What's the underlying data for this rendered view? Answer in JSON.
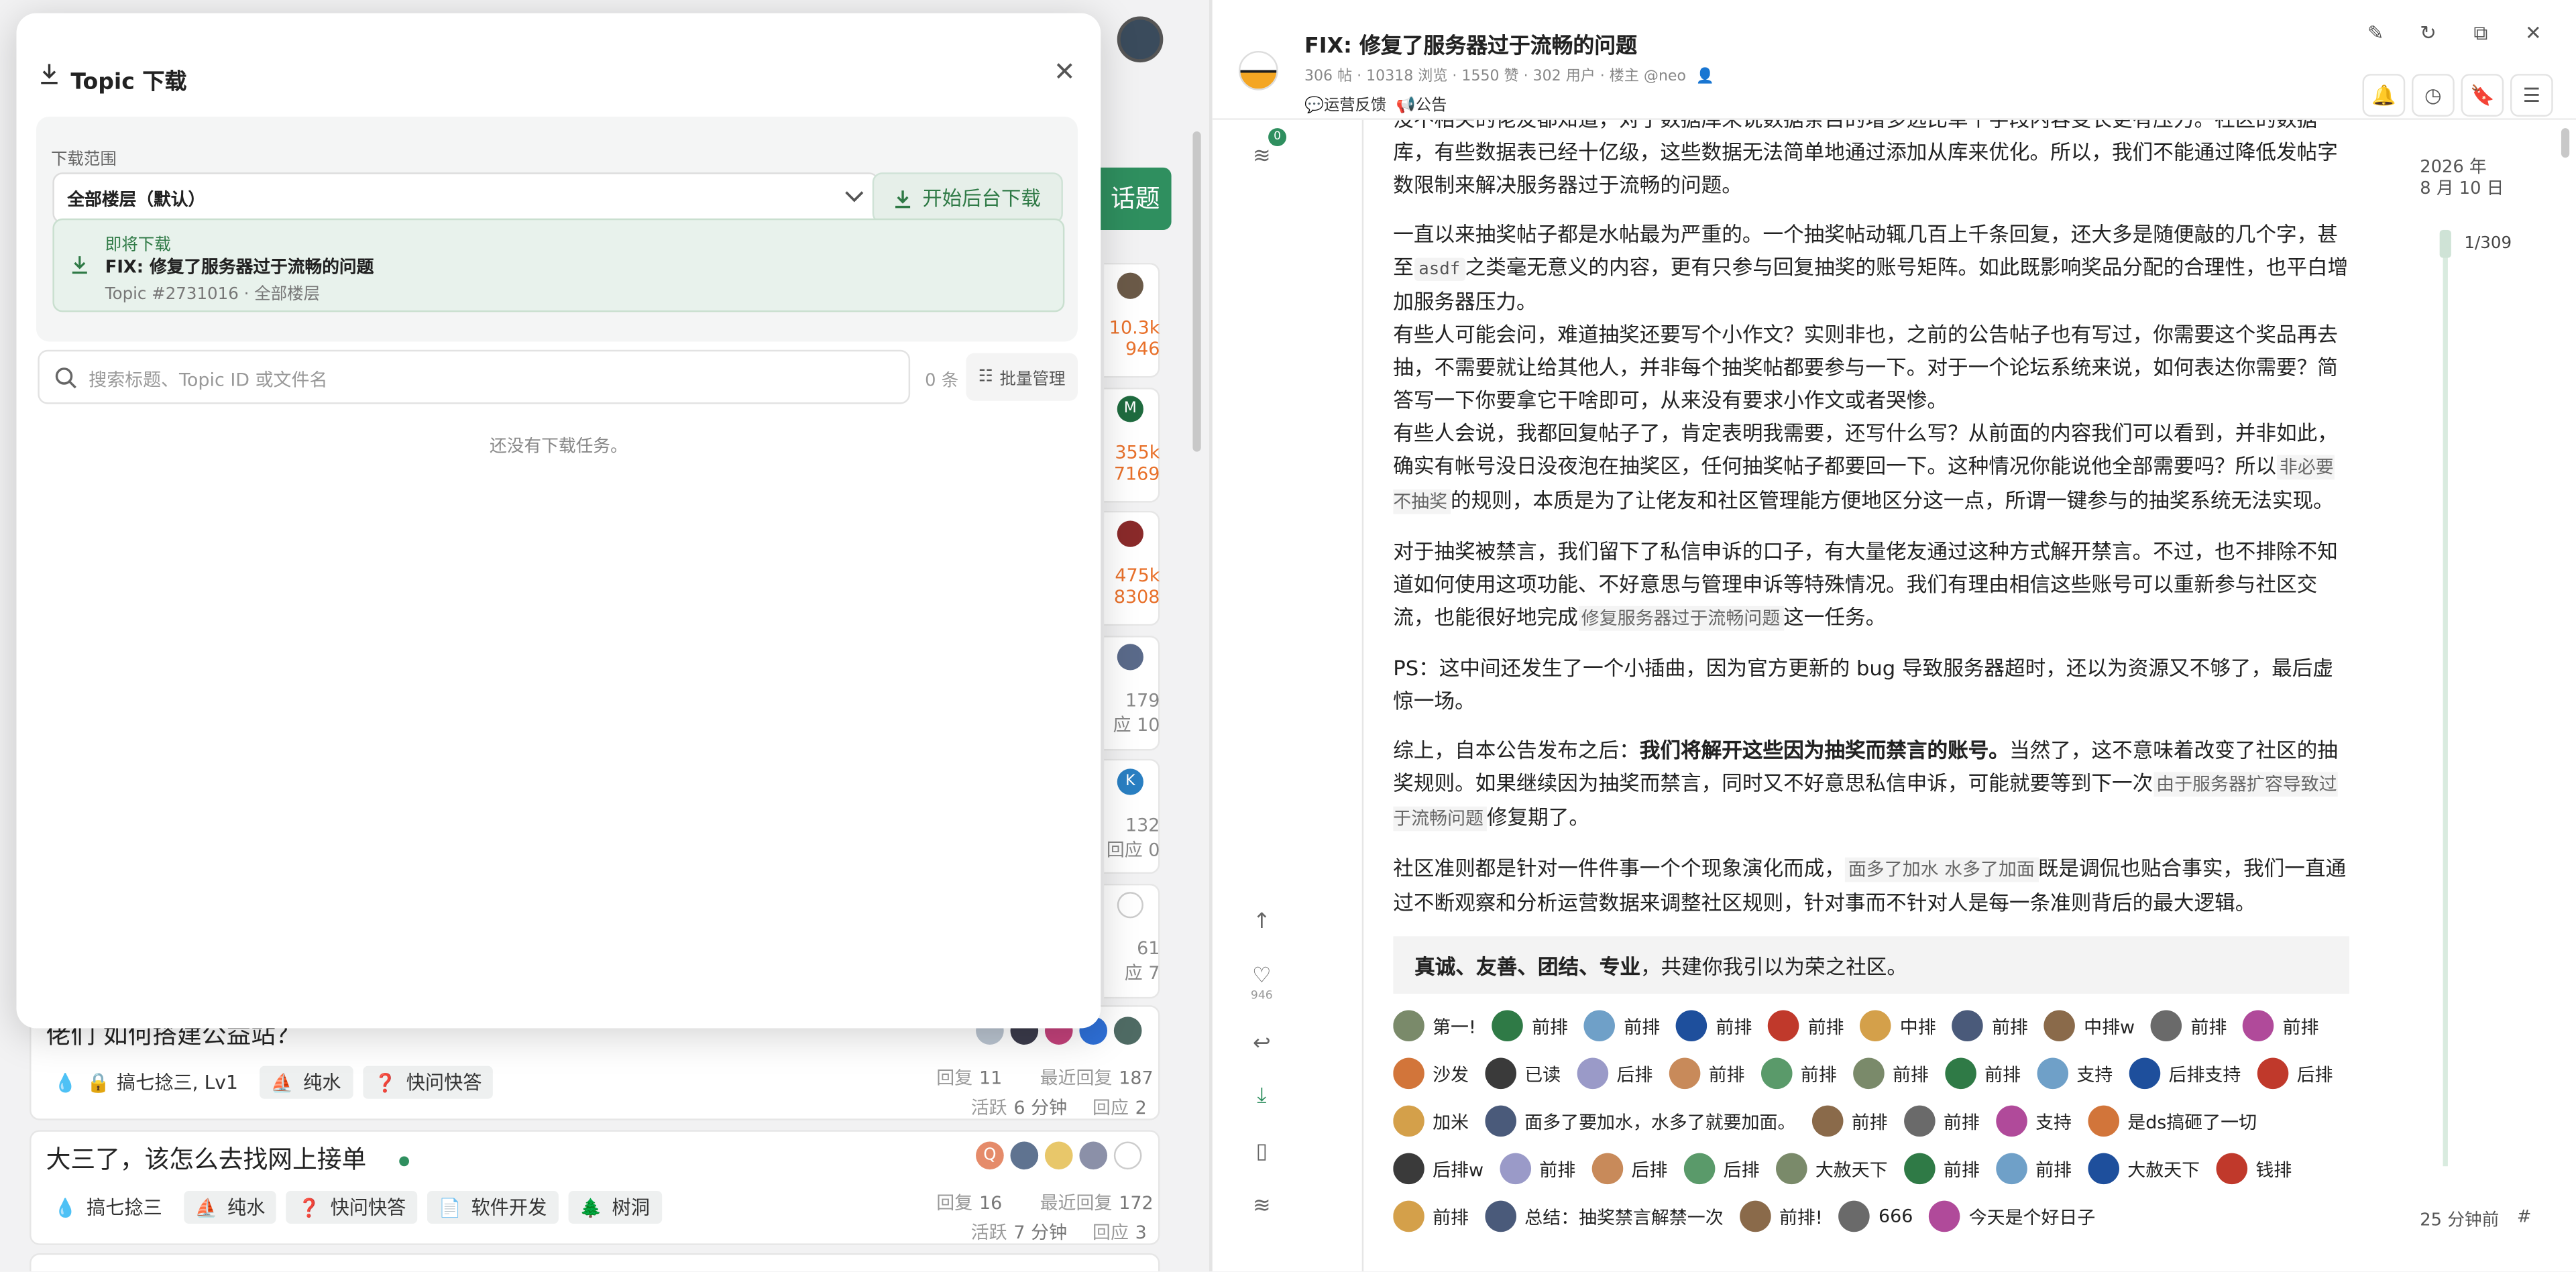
{
  "modal": {
    "title": "Topic 下载",
    "range_label": "下载范围",
    "range_value": "全部楼层（默认）",
    "start_button": "开始后台下载",
    "pending_label": "即将下载",
    "pending_title": "FIX: 修复了服务器过于流畅的问题",
    "pending_sub": "Topic #2731016 · 全部楼层",
    "search_placeholder": "搜索标题、Topic ID 或文件名",
    "count": "0 条",
    "bulk_label": "批量管理",
    "empty_text": "还没有下载任务。"
  },
  "left": {
    "new_topic_label": "话题",
    "right_column": [
      {
        "a": "10.3k",
        "b": "946"
      },
      {
        "a": "355k",
        "b": "7169"
      },
      {
        "a": "475k",
        "b": "8308"
      },
      {
        "a": "179",
        "b": "应 10"
      },
      {
        "a": "132",
        "b": "回应 0"
      },
      {
        "a": "61",
        "b": "应 7"
      }
    ],
    "topics": [
      {
        "title": "佬们 如何搭建公益站？",
        "tags": [
          {
            "icon": "drop-icon",
            "label": "搞七捻三, Lv1"
          },
          {
            "icon": "boat-icon",
            "label": "纯水"
          },
          {
            "icon": "question-icon",
            "label": "快问快答"
          }
        ],
        "reply_label": "回复",
        "reply_count": "11",
        "last_label": "最近回复",
        "last_value": "187",
        "active_label": "活跃",
        "active_value": "6 分钟",
        "resp_label": "回应",
        "resp_value": "2"
      },
      {
        "title": "大三了，该怎么去找网上接单",
        "tags": [
          {
            "icon": "drop-icon",
            "label": "搞七捻三"
          },
          {
            "icon": "boat-icon",
            "label": "纯水"
          },
          {
            "icon": "question-icon",
            "label": "快问快答"
          },
          {
            "icon": "file-icon",
            "label": "软件开发"
          },
          {
            "icon": "tree-icon",
            "label": "树洞"
          }
        ],
        "reply_label": "回复",
        "reply_count": "16",
        "last_label": "最近回复",
        "last_value": "172",
        "active_label": "活跃",
        "active_value": "7 分钟",
        "resp_label": "回应",
        "resp_value": "3"
      }
    ]
  },
  "topic": {
    "title": "FIX: 修复了服务器过于流畅的问题",
    "meta": "306 帖 · 10318 浏览 · 1550 赞 · 302 用户 · 楼主 @neo",
    "tags": [
      "运营反馈",
      "公告"
    ],
    "rail_badge": "0",
    "rail_like_count": "946",
    "paragraphs": {
      "p0": "没不相关的佬友都知道，对于数据库来说数据条目的增多远比单个字段内容变长更有压力。社区的数据库，有些数据表已经十亿级，这些数据无法简单地通过添加从库来优化。所以，我们不能通过降低发帖字数限制来解决服务器过于流畅的问题。",
      "p1a": "一直以来抽奖帖子都是水帖最为严重的。一个抽奖帖动辄几百上千条回复，还大多是随便敲的几个字，甚至",
      "p1code": "asdf",
      "p1b": "之类毫无意义的内容，更有只参与回复抽奖的账号矩阵。如此既影响奖品分配的合理性，也平白增加服务器压力。",
      "p2": "有些人可能会问，难道抽奖还要写个小作文？实则非也，之前的公告帖子也有写过，你需要这个奖品再去抽，不需要就让给其他人，并非每个抽奖帖都要参与一下。对于一个论坛系统来说，如何表达你需要？简答写一下你要拿它干啥即可，从来没有要求小作文或者哭惨。",
      "p3a": "有些人会说，我都回复帖子了，肯定表明我需要，还写什么写？从前面的内容我们可以看到，并非如此，确实有帐号没日没夜泡在抽奖区，任何抽奖帖子都要回一下。这种情况你能说他全部需要吗？所以",
      "p3hl": "非必要不抽奖",
      "p3b": "的规则，本质是为了让佬友和社区管理能方便地区分这一点，所谓一键参与的抽奖系统无法实现。",
      "p4a": "对于抽奖被禁言，我们留下了私信申诉的口子，有大量佬友通过这种方式解开禁言。不过，也不排除不知道如何使用这项功能、不好意思与管理申诉等特殊情况。我们有理由相信这些账号可以重新参与社区交流，也能很好地完成",
      "p4hl": "修复服务器过于流畅问题",
      "p4b": "这一任务。",
      "p5": "PS：这中间还发生了一个小插曲，因为官方更新的 bug 导致服务器超时，还以为资源又不够了，最后虚惊一场。",
      "p6a": "综上，自本公告发布之后：",
      "p6bold": "我们将解开这些因为抽奖而禁言的账号。",
      "p6b": "当然了，这不意味着改变了社区的抽奖规则。如果继续因为抽奖而禁言，同时又不好意思私信申诉，可能就要等到下一次",
      "p6hl": "由于服务器扩容导致过于流畅问题",
      "p6c": "修复期了。",
      "p7a": "社区准则都是针对一件件事一个个现象演化而成，",
      "p7hl": "面多了加水 水多了加面",
      "p7b": "既是调侃也贴合事实，我们一直通过不断观察和分析运营数据来调整社区规则，针对事而不针对人是每一条准则背后的最大逻辑。",
      "quote_bold": "真诚、友善、团结、专业",
      "quote_rest": "，共建你我引以为荣之社区。"
    },
    "reactions": [
      "第一!",
      "前排",
      "前排",
      "前排",
      "前排",
      "中排",
      "前排",
      "中排w",
      "前排",
      "前排",
      "沙发",
      "已读",
      "后排",
      "前排",
      "前排",
      "前排",
      "前排",
      "支持",
      "后排支持",
      "后排",
      "加米",
      "面多了要加水，水多了就要加面。",
      "前排",
      "前排",
      "支持",
      "是ds搞砸了一切",
      "后排w",
      "前排",
      "后排",
      "后排",
      "大赦天下",
      "前排",
      "前排",
      "大赦天下",
      "钱排",
      "前排",
      "总结：抽奖禁言解禁一次",
      "前排!",
      "666",
      "今天是个好日子"
    ],
    "timeline_date_year": "2026 年",
    "timeline_date_day": "8 月 10 日",
    "timeline_pos": "1/309",
    "timeline_time": "25 分钟前",
    "timeline_hash": "#"
  },
  "colors": {
    "accent": "#2f8f5f",
    "orange": "#e8702a"
  }
}
